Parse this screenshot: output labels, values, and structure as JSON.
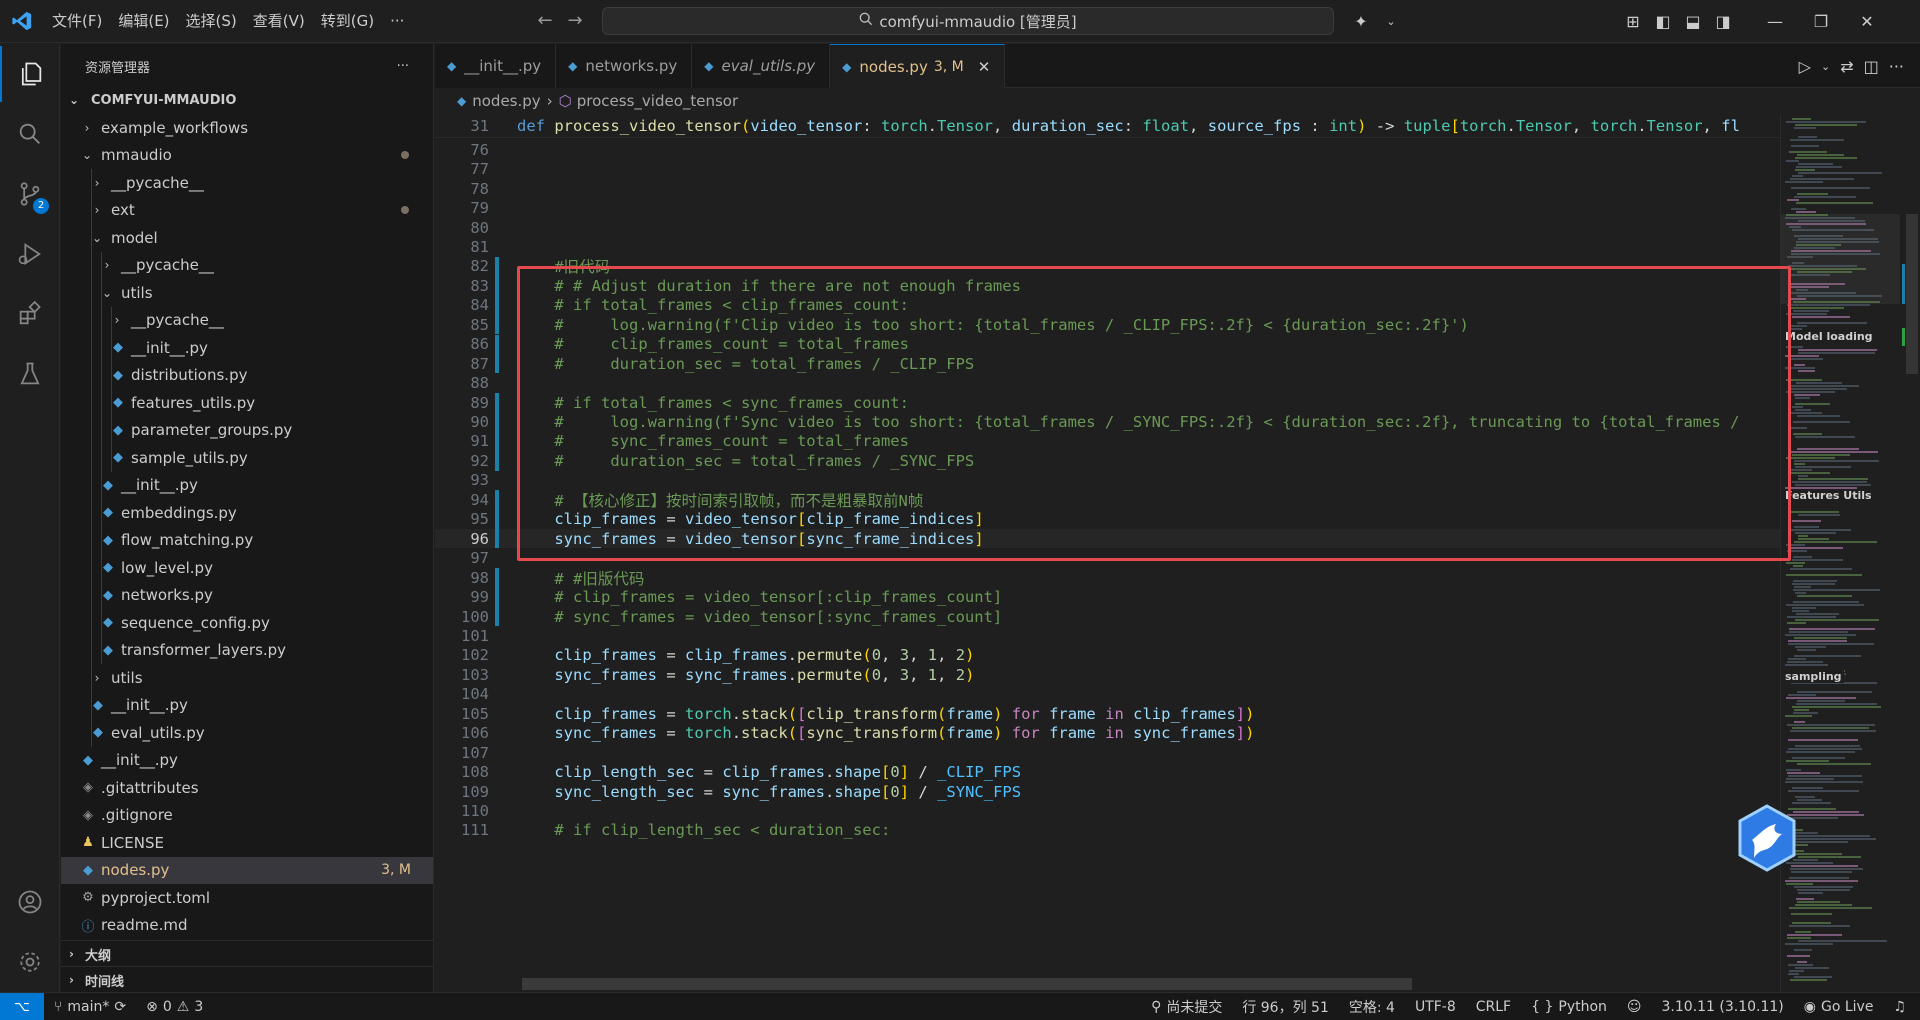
{
  "titlebar": {
    "menu": [
      "文件(F)",
      "编辑(E)",
      "选择(S)",
      "查看(V)",
      "转到(G)",
      "···"
    ],
    "command_center": "comfyui-mmaudio [管理员]"
  },
  "activity": {
    "scm_badge": "2"
  },
  "sidebar": {
    "title": "资源管理器",
    "more": "···",
    "root": "COMFYUI-MMAUDIO",
    "items": [
      {
        "label": "example_workflows",
        "depth": 1,
        "type": "folder",
        "open": false
      },
      {
        "label": "mmaudio",
        "depth": 1,
        "type": "folder",
        "open": true,
        "dot": true
      },
      {
        "label": "__pycache__",
        "depth": 2,
        "type": "folder",
        "open": false
      },
      {
        "label": "ext",
        "depth": 2,
        "type": "folder",
        "open": false,
        "dot": true
      },
      {
        "label": "model",
        "depth": 2,
        "type": "folder",
        "open": true
      },
      {
        "label": "__pycache__",
        "depth": 3,
        "type": "folder",
        "open": false
      },
      {
        "label": "utils",
        "depth": 3,
        "type": "folder",
        "open": true
      },
      {
        "label": "__pycache__",
        "depth": 4,
        "type": "folder",
        "open": false
      },
      {
        "label": "__init__.py",
        "depth": 4,
        "type": "py"
      },
      {
        "label": "distributions.py",
        "depth": 4,
        "type": "py"
      },
      {
        "label": "features_utils.py",
        "depth": 4,
        "type": "py"
      },
      {
        "label": "parameter_groups.py",
        "depth": 4,
        "type": "py"
      },
      {
        "label": "sample_utils.py",
        "depth": 4,
        "type": "py"
      },
      {
        "label": "__init__.py",
        "depth": 3,
        "type": "py"
      },
      {
        "label": "embeddings.py",
        "depth": 3,
        "type": "py"
      },
      {
        "label": "flow_matching.py",
        "depth": 3,
        "type": "py"
      },
      {
        "label": "low_level.py",
        "depth": 3,
        "type": "py"
      },
      {
        "label": "networks.py",
        "depth": 3,
        "type": "py"
      },
      {
        "label": "sequence_config.py",
        "depth": 3,
        "type": "py"
      },
      {
        "label": "transformer_layers.py",
        "depth": 3,
        "type": "py"
      },
      {
        "label": "utils",
        "depth": 2,
        "type": "folder",
        "open": false
      },
      {
        "label": "__init__.py",
        "depth": 2,
        "type": "py"
      },
      {
        "label": "eval_utils.py",
        "depth": 2,
        "type": "py"
      },
      {
        "label": "__init__.py",
        "depth": 1,
        "type": "py"
      },
      {
        "label": ".gitattributes",
        "depth": 1,
        "type": "git"
      },
      {
        "label": ".gitignore",
        "depth": 1,
        "type": "git"
      },
      {
        "label": "LICENSE",
        "depth": 1,
        "type": "license"
      },
      {
        "label": "nodes.py",
        "depth": 1,
        "type": "py",
        "selected": true,
        "status": "3, M"
      },
      {
        "label": "pyproject.toml",
        "depth": 1,
        "type": "gear"
      },
      {
        "label": "readme.md",
        "depth": 1,
        "type": "info"
      }
    ],
    "outline": "大纲",
    "timeline": "时间线"
  },
  "tabs": [
    {
      "label": "__init__.py",
      "italic": false,
      "active": false
    },
    {
      "label": "networks.py",
      "italic": false,
      "active": false
    },
    {
      "label": "eval_utils.py",
      "italic": true,
      "active": false
    },
    {
      "label": "nodes.py",
      "italic": false,
      "active": true,
      "dirty": "3, M"
    }
  ],
  "breadcrumb": {
    "file": "nodes.py",
    "symbol": "process_video_tensor"
  },
  "code": {
    "sticky": {
      "n": "31",
      "text": "def process_video_tensor(video_tensor: torch.Tensor, duration_sec: float, source_fps : int) -> tuple[torch.Tensor, torch.Tensor, fl"
    },
    "lines": [
      {
        "n": "76",
        "text": ""
      },
      {
        "n": "77",
        "text": ""
      },
      {
        "n": "78",
        "text": ""
      },
      {
        "n": "79",
        "text": ""
      },
      {
        "n": "80",
        "text": ""
      },
      {
        "n": "81",
        "text": ""
      },
      {
        "n": "82",
        "text": "    #旧代码"
      },
      {
        "n": "83",
        "text": "    # # Adjust duration if there are not enough frames"
      },
      {
        "n": "84",
        "text": "    # if total_frames < clip_frames_count:"
      },
      {
        "n": "85",
        "text": "    #     log.warning(f'Clip video is too short: {total_frames / _CLIP_FPS:.2f} < {duration_sec:.2f}')"
      },
      {
        "n": "86",
        "text": "    #     clip_frames_count = total_frames"
      },
      {
        "n": "87",
        "text": "    #     duration_sec = total_frames / _CLIP_FPS"
      },
      {
        "n": "88",
        "text": ""
      },
      {
        "n": "89",
        "text": "    # if total_frames < sync_frames_count:"
      },
      {
        "n": "90",
        "text": "    #     log.warning(f'Sync video is too short: {total_frames / _SYNC_FPS:.2f} < {duration_sec:.2f}, truncating to {total_frames /"
      },
      {
        "n": "91",
        "text": "    #     sync_frames_count = total_frames"
      },
      {
        "n": "92",
        "text": "    #     duration_sec = total_frames / _SYNC_FPS"
      },
      {
        "n": "93",
        "text": ""
      },
      {
        "n": "94",
        "text": "    # 【核心修正】按时间索引取帧，而不是粗暴取前N帧"
      },
      {
        "n": "95",
        "text": "    clip_frames = video_tensor[clip_frame_indices]"
      },
      {
        "n": "96",
        "text": "    sync_frames = video_tensor[sync_frame_indices]"
      },
      {
        "n": "97",
        "text": ""
      },
      {
        "n": "98",
        "text": "    # #旧版代码"
      },
      {
        "n": "99",
        "text": "    # clip_frames = video_tensor[:clip_frames_count]"
      },
      {
        "n": "100",
        "text": "    # sync_frames = video_tensor[:sync_frames_count]"
      },
      {
        "n": "101",
        "text": ""
      },
      {
        "n": "102",
        "text": "    clip_frames = clip_frames.permute(0, 3, 1, 2)"
      },
      {
        "n": "103",
        "text": "    sync_frames = sync_frames.permute(0, 3, 1, 2)"
      },
      {
        "n": "104",
        "text": ""
      },
      {
        "n": "105",
        "text": "    clip_frames = torch.stack([clip_transform(frame) for frame in clip_frames])"
      },
      {
        "n": "106",
        "text": "    sync_frames = torch.stack([sync_transform(frame) for frame in sync_frames])"
      },
      {
        "n": "107",
        "text": ""
      },
      {
        "n": "108",
        "text": "    clip_length_sec = clip_frames.shape[0] / _CLIP_FPS"
      },
      {
        "n": "109",
        "text": "    sync_length_sec = sync_frames.shape[0] / _SYNC_FPS"
      },
      {
        "n": "110",
        "text": ""
      },
      {
        "n": "111",
        "text": "    # if clip_length_sec < duration_sec:"
      }
    ],
    "current_line": "96"
  },
  "minimap": {
    "labels": [
      "Model loading",
      "Features Utils",
      "sampling"
    ]
  },
  "statusbar": {
    "branch": "main*",
    "errors": "0",
    "warnings": "3",
    "uncommitted": "尚未提交",
    "position": "行 96，列 51",
    "spaces": "空格: 4",
    "encoding": "UTF-8",
    "eol": "CRLF",
    "language": "Python",
    "interpreter": "3.10.11 (3.10.11)",
    "golive": "Go Live"
  },
  "colors": {
    "accent": "#0078d4",
    "highlight_box": "#e5484d",
    "modified": "#e2c08d"
  }
}
